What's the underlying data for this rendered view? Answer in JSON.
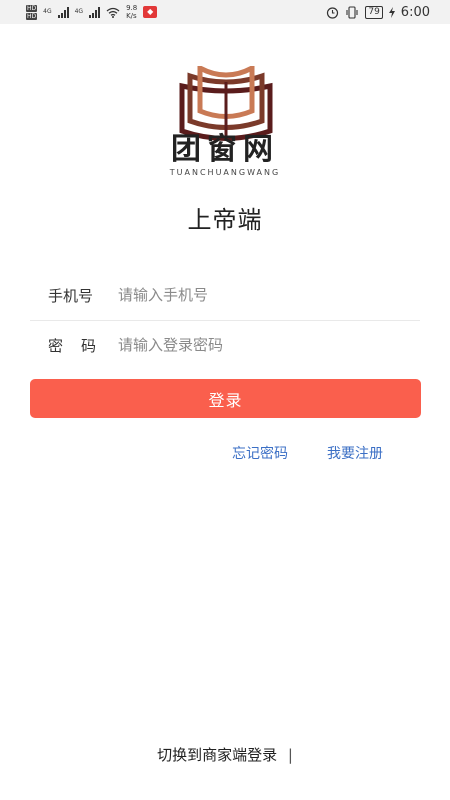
{
  "status_bar": {
    "hd1": "HD",
    "hd2": "HD",
    "net1": "4G",
    "net2": "4G",
    "speed_value": "9.8",
    "speed_unit": "K/s",
    "battery": "79",
    "time": "6:00"
  },
  "brand": {
    "name": "团窗网",
    "pinyin": "TUANCHUANGWANG",
    "logo_colors": {
      "outer": "#5a1c1c",
      "mid": "#7b3a2a",
      "inner": "#c97a55"
    }
  },
  "page": {
    "subtitle": "上帝端"
  },
  "form": {
    "phone_label": "手机号",
    "phone_placeholder": "请输入手机号",
    "phone_value": "",
    "password_label": "密码",
    "password_placeholder": "请输入登录密码",
    "password_value": "",
    "login_label": "登录"
  },
  "links": {
    "forgot_password": "忘记密码",
    "register": "我要注册",
    "switch_merchant": "切换到商家端登录"
  },
  "colors": {
    "primary": "#fa5f4d",
    "link": "#3b6fc5"
  }
}
